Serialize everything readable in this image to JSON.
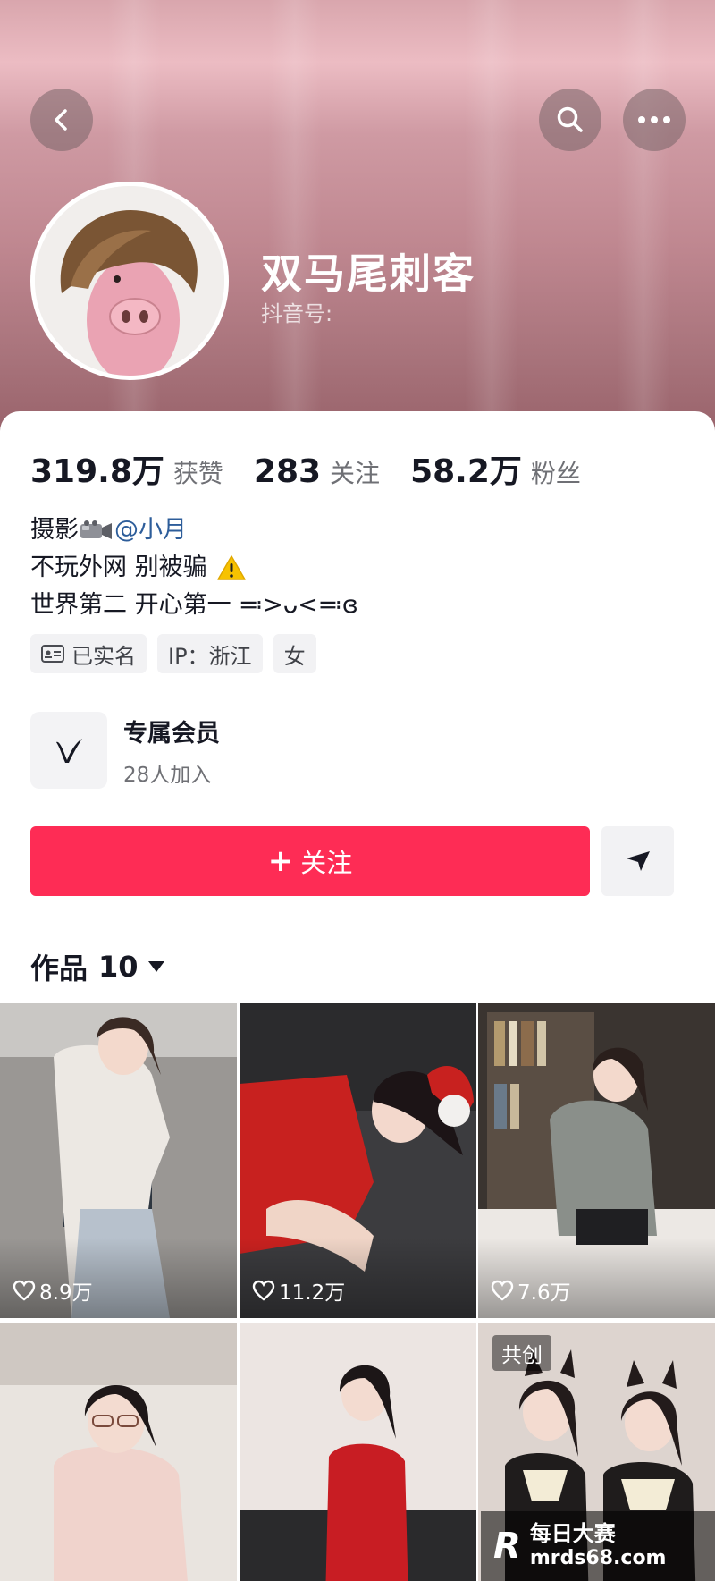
{
  "header": {
    "nickname": "双马尾刺客",
    "douyin_id_label": "抖音号:"
  },
  "stats": [
    {
      "value": "319.8万",
      "label": "获赞"
    },
    {
      "value": "283",
      "label": "关注"
    },
    {
      "value": "58.2万",
      "label": "粉丝"
    }
  ],
  "bio": {
    "line1_prefix": "摄影",
    "line1_mention": "@小月",
    "line2": "不玩外网 别被骗",
    "line3": "世界第二 开心第一 ≕>ᴗ<≕ɞ"
  },
  "tags": [
    {
      "label": "已实名",
      "icon": "id-card-icon"
    },
    {
      "label": "IP：浙江"
    },
    {
      "label": "女"
    }
  ],
  "member": {
    "title": "专属会员",
    "subtitle": "28人加入"
  },
  "actions": {
    "follow_label": "关注"
  },
  "works": {
    "label": "作品",
    "count": "10"
  },
  "videos": [
    {
      "likes": "8.9万"
    },
    {
      "likes": "11.2万"
    },
    {
      "likes": "7.6万"
    },
    {
      "likes": ""
    },
    {
      "likes": ""
    },
    {
      "likes": "",
      "badge": "共创"
    }
  ],
  "watermark": {
    "logo": "R",
    "title": "每日大赛",
    "url": "mrds68.com"
  },
  "colors": {
    "accent": "#fe2c55",
    "mention": "#2d5d9a"
  }
}
